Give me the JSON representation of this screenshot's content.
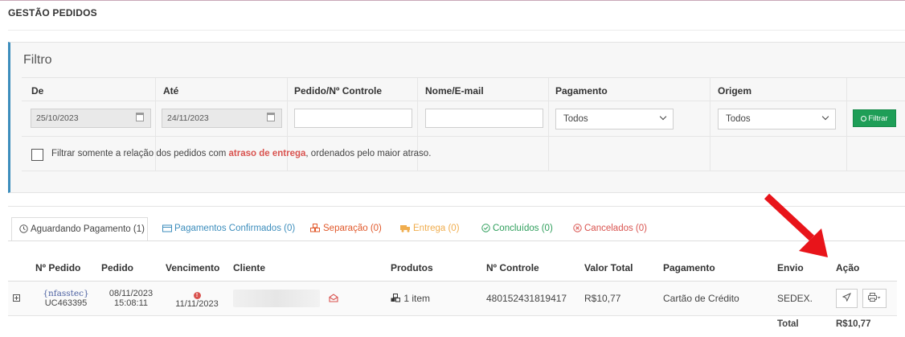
{
  "page_title": "GESTÃO PEDIDOS",
  "filter": {
    "heading": "Filtro",
    "labels": {
      "from": "De",
      "to": "Até",
      "order": "Pedido/Nº Controle",
      "name": "Nome/E-mail",
      "payment": "Pagamento",
      "origin": "Origem"
    },
    "from_value": "25/10/2023",
    "to_value": "24/11/2023",
    "payment_value": "Todos",
    "origin_value": "Todos",
    "button_label": "Filtrar",
    "checkbox_checked": false,
    "checkbox_text_before": "Filtrar somente a relação dos pedidos com ",
    "checkbox_text_highlight": "atraso de entrega",
    "checkbox_text_after": ", ordenados pelo maior atraso."
  },
  "tabs": [
    {
      "label": "Aguardando Pagamento (1)",
      "color": "#444444",
      "icon": "clock-icon"
    },
    {
      "label": "Pagamentos Confirmados (0)",
      "color": "#3c8dbc",
      "icon": "card-icon"
    },
    {
      "label": "Separação (0)",
      "color": "#e1592b",
      "icon": "boxes-icon"
    },
    {
      "label": "Entrega (0)",
      "color": "#f0ad4e",
      "icon": "truck-icon"
    },
    {
      "label": "Concluídos (0)",
      "color": "#2e9e5b",
      "icon": "check-circle-icon"
    },
    {
      "label": "Cancelados (0)",
      "color": "#d9534f",
      "icon": "cancel-circle-icon"
    }
  ],
  "table": {
    "headers": {
      "order_no": "Nº Pedido",
      "date": "Pedido",
      "due": "Vencimento",
      "client": "Cliente",
      "products": "Produtos",
      "control": "Nº Controle",
      "total": "Valor Total",
      "payment": "Pagamento",
      "shipping": "Envio",
      "action": "Ação"
    },
    "row": {
      "store": "{nfasstec}",
      "order_code": "UC463395",
      "date": "08/11/2023",
      "time": "15:08:11",
      "due": "11/11/2023",
      "products": "1 item",
      "control": "480152431819417",
      "total": "R$10,77",
      "payment": "Cartão de Crédito",
      "shipping": "SEDEX."
    },
    "footer": {
      "label": "Total",
      "value": "R$10,77"
    }
  },
  "colors": {
    "accent_blue": "#3c8dbc",
    "filter_green": "#1e9e57",
    "annotation_red": "#e8141a",
    "highlight_red": "#d9534f"
  }
}
